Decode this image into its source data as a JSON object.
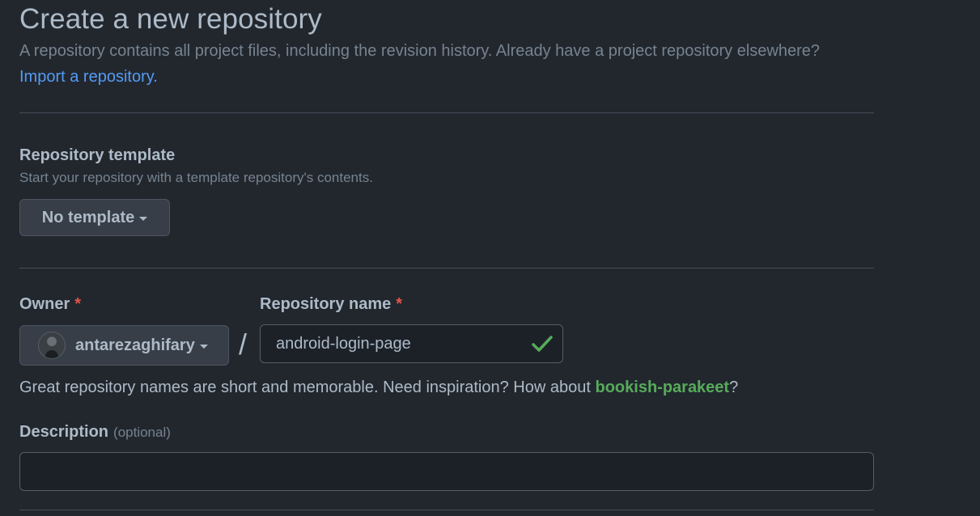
{
  "header": {
    "title": "Create a new repository",
    "subtitle": "A repository contains all project files, including the revision history. Already have a project repository elsewhere?",
    "import_link": "Import a repository."
  },
  "template_section": {
    "heading": "Repository template",
    "note": "Start your repository with a template repository's contents.",
    "button_label": "No template"
  },
  "owner": {
    "label": "Owner",
    "required_mark": "*",
    "selected": "antarezaghifary"
  },
  "separator": "/",
  "repo_name": {
    "label": "Repository name",
    "required_mark": "*",
    "value": "android-login-page",
    "status_icon": "check-icon",
    "status_color": "#57ab5a"
  },
  "name_hint": {
    "prefix": "Great repository names are short and memorable. Need inspiration? How about ",
    "suggestion": "bookish-parakeet",
    "suffix": "?"
  },
  "description": {
    "label": "Description",
    "optional_note": "(optional)",
    "value": ""
  },
  "theme": {
    "background": "#22272e",
    "link": "#539bf5",
    "success": "#57ab5a",
    "danger": "#e5534b"
  }
}
